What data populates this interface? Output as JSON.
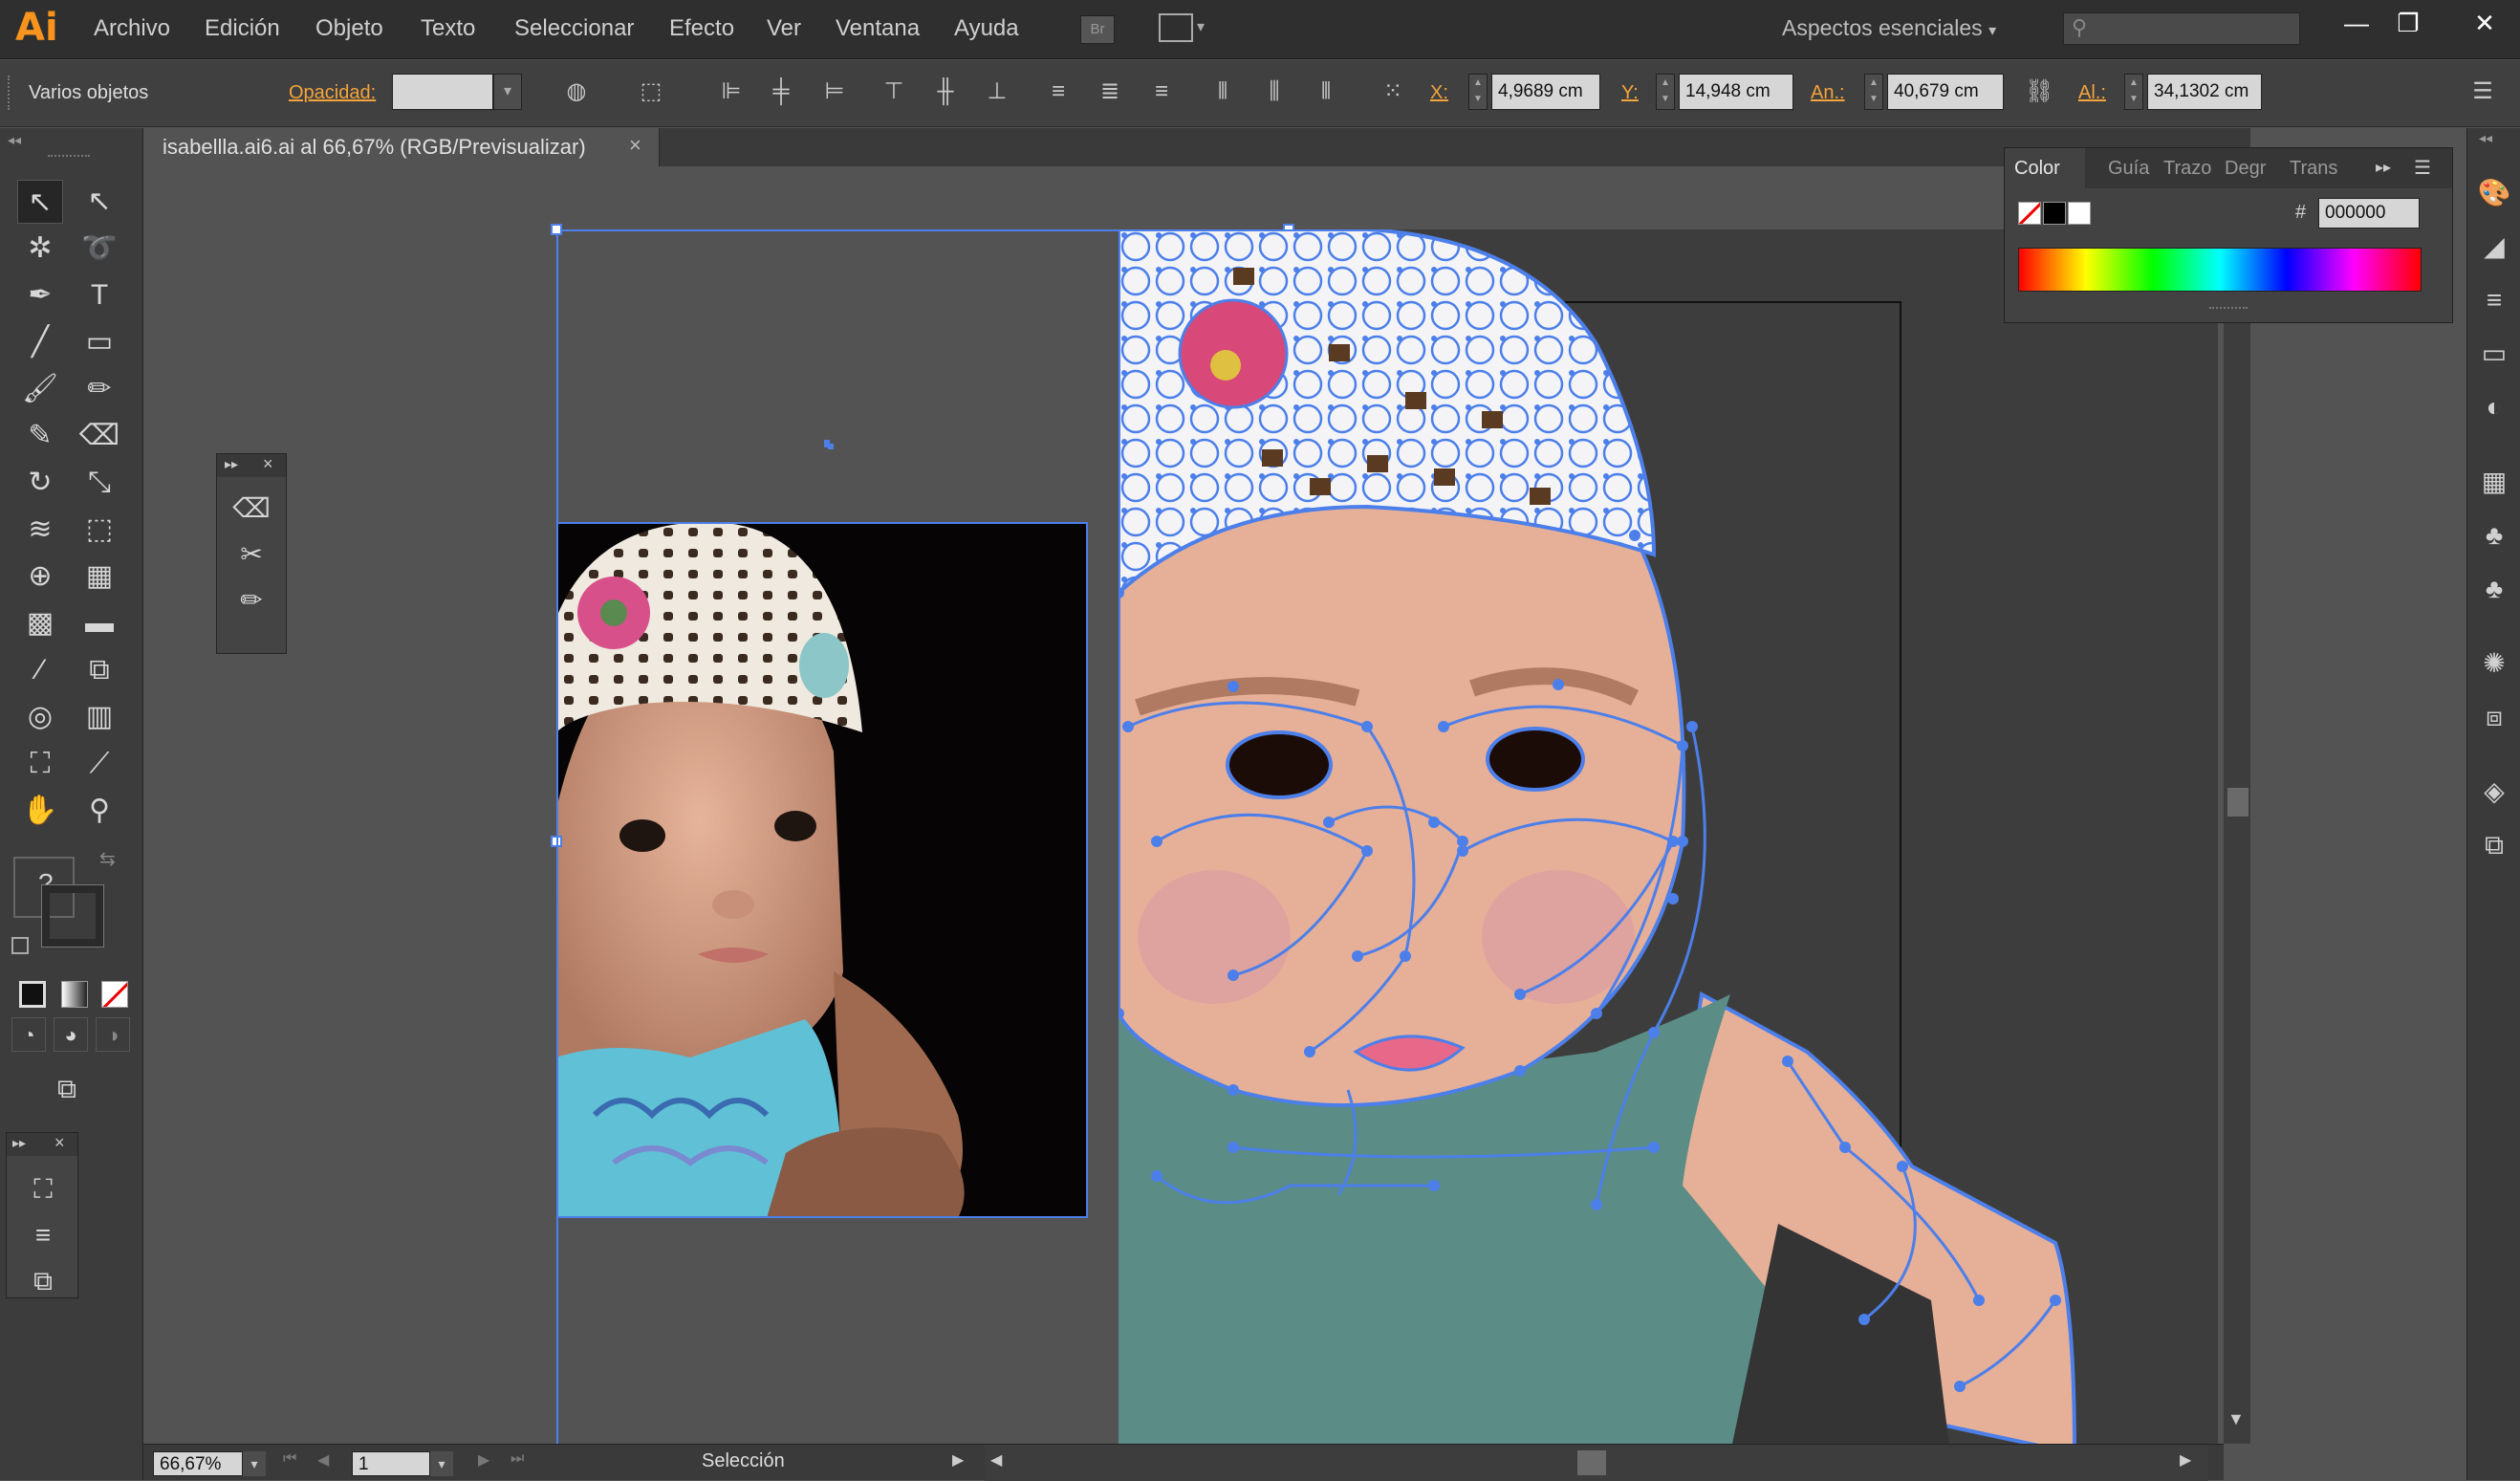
{
  "app": {
    "logo": "Ai",
    "accent_color": "#f7941d"
  },
  "menu": [
    "Archivo",
    "Edición",
    "Objeto",
    "Texto",
    "Seleccionar",
    "Efecto",
    "Ver",
    "Ventana",
    "Ayuda"
  ],
  "menu_extra": {
    "bridge_label": "Br",
    "workspace": "Aspectos esenciales",
    "search_placeholder": ""
  },
  "window_controls": {
    "minimize": "—",
    "restore": "❐",
    "close": "✕"
  },
  "control_bar": {
    "selection_label": "Varios objetos",
    "opacity_label": "Opacidad:",
    "opacity_value": "",
    "x_label": "X:",
    "x_value": "4,9689 cm",
    "y_label": "Y:",
    "y_value": "14,948 cm",
    "w_label": "An.:",
    "w_value": "40,679 cm",
    "h_label": "Al.:",
    "h_value": "34,1302 cm"
  },
  "document_tab": {
    "title": "isabellla.ai6.ai al 66,67% (RGB/Previsualizar)",
    "close": "×"
  },
  "tools": [
    {
      "name": "selection-tool",
      "glyph": "↖",
      "selected": true
    },
    {
      "name": "direct-selection-tool",
      "glyph": "↖"
    },
    {
      "name": "magic-wand-tool",
      "glyph": "✲"
    },
    {
      "name": "lasso-tool",
      "glyph": "➰"
    },
    {
      "name": "pen-tool",
      "glyph": "✒"
    },
    {
      "name": "type-tool",
      "glyph": "T"
    },
    {
      "name": "line-tool",
      "glyph": "╱"
    },
    {
      "name": "rectangle-tool",
      "glyph": "▭"
    },
    {
      "name": "paintbrush-tool",
      "glyph": "🖌"
    },
    {
      "name": "pencil-tool",
      "glyph": "✏"
    },
    {
      "name": "blob-brush-tool",
      "glyph": "✎"
    },
    {
      "name": "eraser-tool",
      "glyph": "⌫"
    },
    {
      "name": "rotate-tool",
      "glyph": "↻"
    },
    {
      "name": "scale-tool",
      "glyph": "⤡"
    },
    {
      "name": "warp-tool",
      "glyph": "≋"
    },
    {
      "name": "free-transform-tool",
      "glyph": "⬚"
    },
    {
      "name": "shape-builder-tool",
      "glyph": "⊕"
    },
    {
      "name": "perspective-grid-tool",
      "glyph": "▦"
    },
    {
      "name": "mesh-tool",
      "glyph": "▩"
    },
    {
      "name": "gradient-tool",
      "glyph": "▬"
    },
    {
      "name": "eyedropper-tool",
      "glyph": "⁄"
    },
    {
      "name": "blend-tool",
      "glyph": "⧉"
    },
    {
      "name": "symbol-sprayer-tool",
      "glyph": "◎"
    },
    {
      "name": "column-graph-tool",
      "glyph": "▥"
    },
    {
      "name": "artboard-tool",
      "glyph": "⛶"
    },
    {
      "name": "slice-tool",
      "glyph": "⟋"
    },
    {
      "name": "hand-tool",
      "glyph": "✋"
    },
    {
      "name": "zoom-tool",
      "glyph": "⚲"
    }
  ],
  "tool_extra": {
    "unknown_fill": "?",
    "swap": "⇆"
  },
  "float_panel_tools": [
    "⌫",
    "✂",
    "✏"
  ],
  "float_panel_2": [
    "⛶",
    "≡",
    "⧉"
  ],
  "color_panel": {
    "tabs": [
      "Color",
      "Guía",
      "Trazo",
      "Degr",
      "Trans"
    ],
    "hex_label": "#",
    "hex_value": "000000"
  },
  "right_icons": [
    "🎨",
    "◢",
    "≡",
    "▭",
    "◐",
    "▦",
    "♣",
    "♣",
    "✺",
    "⧈",
    "◈",
    "⧉"
  ],
  "status": {
    "zoom": "66,67%",
    "artboard": "1",
    "tool": "Selección"
  },
  "artwork_colors": {
    "skin": "#e6b098",
    "shirt": "#5b8d86",
    "hat": "#f4f4f6",
    "path": "#4c7fea",
    "bg": "#3d3d3d"
  }
}
